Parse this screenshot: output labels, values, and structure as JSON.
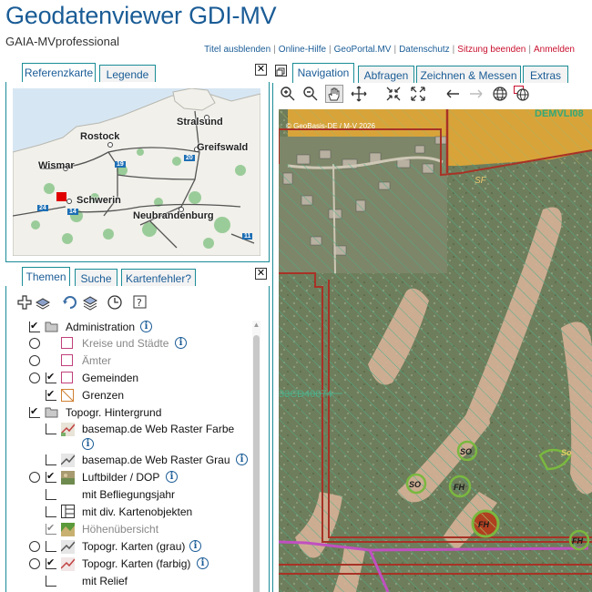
{
  "header": {
    "title": "Geodatenviewer GDI-MV",
    "subtitle": "GAIA-MVprofessional",
    "links": [
      {
        "label": "Titel ausblenden",
        "style": "normal"
      },
      {
        "label": "Online-Hilfe",
        "style": "normal"
      },
      {
        "label": "GeoPortal.MV",
        "style": "normal"
      },
      {
        "label": "Datenschutz",
        "style": "normal"
      },
      {
        "label": "Sitzung beenden",
        "style": "red"
      },
      {
        "label": "Anmelden",
        "style": "red"
      }
    ]
  },
  "left_top_tabs": [
    "Referenzkarte",
    "Legende"
  ],
  "refmap": {
    "cities": [
      "Stralsund",
      "Rostock",
      "Greifswald",
      "Wismar",
      "Schwerin",
      "Neubrandenburg"
    ],
    "road_badges": [
      "19",
      "20",
      "24",
      "14",
      "11"
    ]
  },
  "left_bottom_tabs": [
    "Themen",
    "Suche",
    "Kartenfehler?"
  ],
  "theme_tools": [
    "add-layer-icon",
    "layers-icon",
    "refresh-icon",
    "layers-stack-icon",
    "clock-icon",
    "help-icon"
  ],
  "tree": [
    {
      "label": "Administration",
      "info": true
    },
    {
      "label": "Kreise und Städte",
      "info": true
    },
    {
      "label": "Ämter",
      "info": false
    },
    {
      "label": "Gemeinden",
      "info": false
    },
    {
      "label": "Grenzen",
      "info": false
    },
    {
      "label": "Topogr. Hintergrund",
      "info": false
    },
    {
      "label": "basemap.de Web Raster Farbe",
      "info": true
    },
    {
      "label": "basemap.de Web Raster Grau",
      "info": true
    },
    {
      "label": "Luftbilder / DOP",
      "info": true
    },
    {
      "label": "mit Befliegungsjahr",
      "info": false
    },
    {
      "label": "mit div. Kartenobjekten",
      "info": false
    },
    {
      "label": "Höhenübersicht",
      "info": false
    },
    {
      "label": "Topogr. Karten (grau)",
      "info": true
    },
    {
      "label": "Topogr. Karten (farbig)",
      "info": true
    },
    {
      "label": "mit Relief",
      "info": false
    }
  ],
  "right_tabs": [
    "Navigation",
    "Abfragen",
    "Zeichnen & Messen",
    "Extras"
  ],
  "nav_tools": [
    "zoom-in-icon",
    "zoom-out-icon",
    "pan-hand-icon",
    "move-icon",
    "zoom-full-icon",
    "zoom-extent-icon",
    "back-icon",
    "forward-icon",
    "globe-icon",
    "globe-select-icon"
  ],
  "map": {
    "copyright": "© GeoBasis-DE / M-V 2026",
    "labels": [
      "DEMVLI08",
      "SF",
      "33CD40074",
      "SO",
      "SO",
      "FH",
      "FH",
      "FH",
      "So"
    ]
  },
  "colors": {
    "brand_blue": "#1a5c96",
    "link_red": "#c8102e",
    "tab_border": "#1a8c96"
  }
}
